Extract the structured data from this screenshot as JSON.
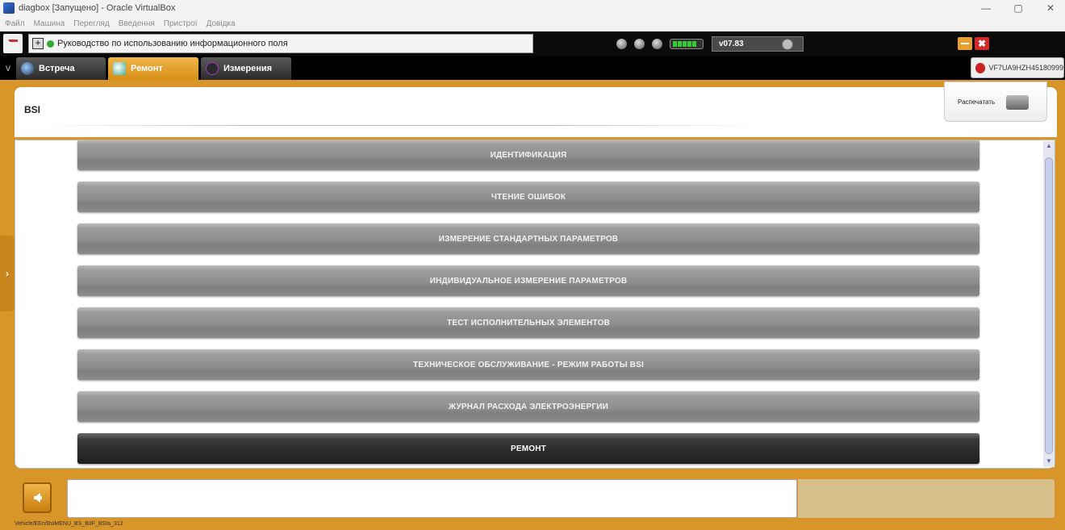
{
  "window": {
    "title": "diagbox [Запущено] - Oracle VirtualBox",
    "minimize": "—",
    "maximize": "▢",
    "close": "✕"
  },
  "menubar": [
    "Файл",
    "Машина",
    "Перегляд",
    "Введення",
    "Пристрої",
    "Довідка"
  ],
  "header": {
    "info_text": "Руководство по использованию информационного поля",
    "plus": "+",
    "version": "v07.83",
    "close_glyph": "✖"
  },
  "tabs": [
    {
      "label": "Встреча"
    },
    {
      "label": "Ремонт"
    },
    {
      "label": "Измерения"
    }
  ],
  "tab_collapse": "v",
  "vin": "VF7UA9HZH45180999",
  "page": {
    "title": "BSI",
    "print_label": "Распечатать"
  },
  "menu": [
    {
      "label": "ИДЕНТИФИКАЦИЯ"
    },
    {
      "label": "ЧТЕНИЕ ОШИБОК"
    },
    {
      "label": "ИЗМЕРЕНИЕ СТАНДАРТНЫХ ПАРАМЕТРОВ"
    },
    {
      "label": "ИНДИВИДУАЛЬНОЕ ИЗМЕРЕНИЕ ПАРАМЕТРОВ"
    },
    {
      "label": "ТЕСТ ИСПОЛНИТЕЛЬНЫХ ЭЛЕМЕНТОВ"
    },
    {
      "label": "ТЕХНИЧЕСКОЕ ОБСЛУЖИВАНИЕ - РЕЖИМ РАБОТЫ BSI"
    },
    {
      "label": "ЖУРНАЛ РАСХОДА ЭЛЕКТРОЭНЕРГИИ"
    },
    {
      "label": "РЕМОНТ"
    }
  ],
  "side_toggle": "›",
  "footer": {
    "path": "Vehicle/EEn/BsiMENU_BS_BIIF_BSIa_312"
  },
  "colors": {
    "accent_orange": "#d8952a",
    "selected_tab": "#e8a030",
    "menu_button": "#8e8e8e",
    "menu_button_selected": "#2b2b2b"
  }
}
